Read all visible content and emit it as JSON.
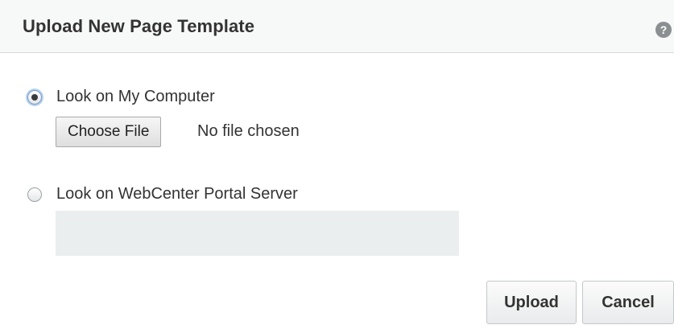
{
  "dialog": {
    "title": "Upload New Page Template",
    "help_icon": "question-circle-icon",
    "help_glyph": "?"
  },
  "options": {
    "my_computer": {
      "label": "Look on My Computer",
      "selected": true,
      "choose_file_label": "Choose File",
      "file_status": "No file chosen"
    },
    "server": {
      "label": "Look on WebCenter Portal Server",
      "selected": false,
      "field_value": ""
    }
  },
  "footer": {
    "upload_label": "Upload",
    "cancel_label": "Cancel"
  },
  "colors": {
    "header_bg": "#f7f8f8",
    "field_bg": "#eaeeef",
    "radio_focus": "#b9d3ee"
  }
}
